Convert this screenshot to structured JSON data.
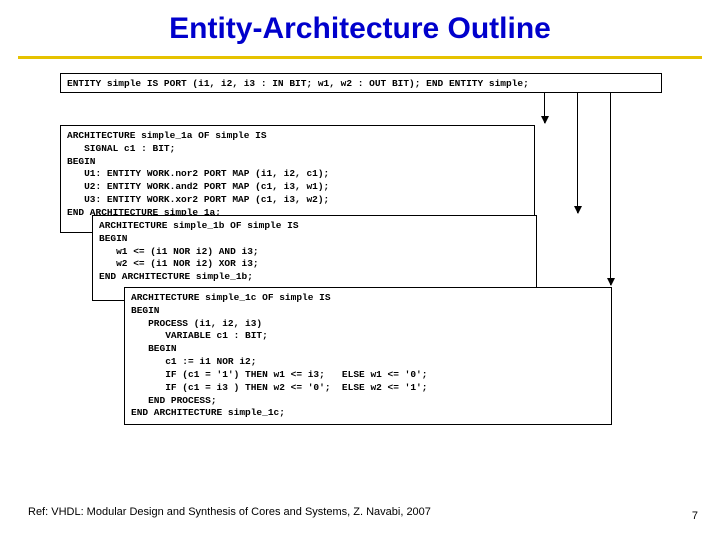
{
  "title": "Entity-Architecture Outline",
  "entity_code": "ENTITY simple IS PORT (i1, i2, i3 : IN BIT; w1, w2 : OUT BIT); END ENTITY simple;",
  "arch_a": "ARCHITECTURE simple_1a OF simple IS\n   SIGNAL c1 : BIT;\nBEGIN\n   U1: ENTITY WORK.nor2 PORT MAP (i1, i2, c1);\n   U2: ENTITY WORK.and2 PORT MAP (c1, i3, w1);\n   U3: ENTITY WORK.xor2 PORT MAP (c1, i3, w2);\nEND ARCHITECTURE simple_1a;",
  "arch_b": "ARCHITECTURE simple_1b OF simple IS\nBEGIN\n   w1 <= (i1 NOR i2) AND i3;\n   w2 <= (i1 NOR i2) XOR i3;\nEND ARCHITECTURE simple_1b;",
  "arch_c": "ARCHITECTURE simple_1c OF simple IS\nBEGIN\n   PROCESS (i1, i2, i3)\n      VARIABLE c1 : BIT;\n   BEGIN\n      c1 := i1 NOR i2;\n      IF (c1 = '1') THEN w1 <= i3;   ELSE w1 <= '0';\n      IF (c1 = i3 ) THEN w2 <= '0';  ELSE w2 <= '1';\n   END PROCESS;\nEND ARCHITECTURE simple_1c;",
  "reference": "Ref: VHDL: Modular Design and Synthesis of Cores and Systems, Z. Navabi, 2007",
  "page_number": "7"
}
